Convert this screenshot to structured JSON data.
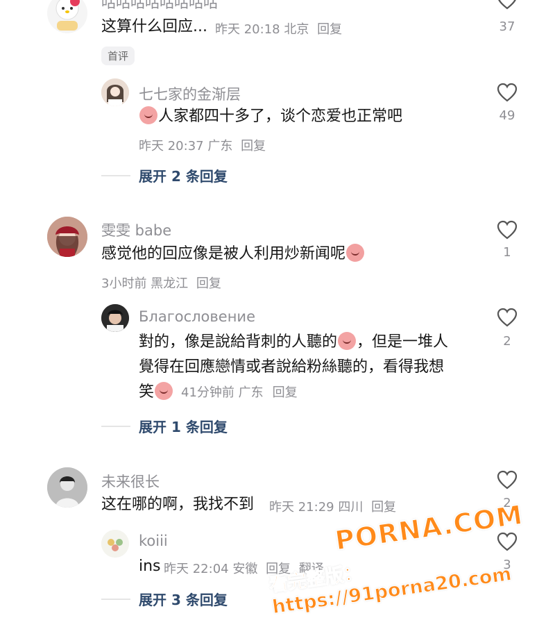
{
  "comments": [
    {
      "name": "咕咕咕咕咕咕咕咕",
      "text": "这算什么回应...",
      "meta": "昨天 20:18 北京",
      "reply": "回复",
      "likes": "37",
      "badge": "首评"
    },
    {
      "name": "七七家的金渐层",
      "text": "人家都四十多了，谈个恋爱也正常吧",
      "meta": "昨天 20:37 广东",
      "reply": "回复",
      "likes": "49",
      "expand": "展开 2 条回复"
    },
    {
      "name": "雯雯 babe",
      "text": "感觉他的回应像是被人利用炒新闻呢",
      "meta": "3小时前 黑龙江",
      "reply": "回复",
      "likes": "1"
    },
    {
      "name": "Благословение",
      "text_line1a": "對的，像是說給背刺的人聽的",
      "text_line1b": "，但是一堆人",
      "text_line2": "覺得在回應戀情或者說給粉絲聽的，看得我想",
      "text_line3": "笑",
      "meta": "41分钟前 广东",
      "reply": "回复",
      "likes": "2",
      "expand": "展开 1 条回复"
    },
    {
      "name": "未来很长",
      "text": "这在哪的啊，我找不到",
      "meta": "昨天 21:29 四川",
      "reply": "回复",
      "likes": "2"
    },
    {
      "name": "koiii",
      "text": "ins",
      "meta": "昨天 22:04 安徽",
      "reply": "回复",
      "reply2": "翻译",
      "likes": "3",
      "expand": "展开 3 条回复"
    }
  ],
  "watermark": {
    "brand": "PORNA.COM",
    "url": "看完整版：https://91porna20.com"
  },
  "colors": {
    "accent": "#2f4a6d",
    "muted": "#8e8e93",
    "watermark": "#ff8a1a"
  },
  "icons": {
    "like": "heart-outline-icon",
    "emoji": "crying-face-emoji"
  }
}
